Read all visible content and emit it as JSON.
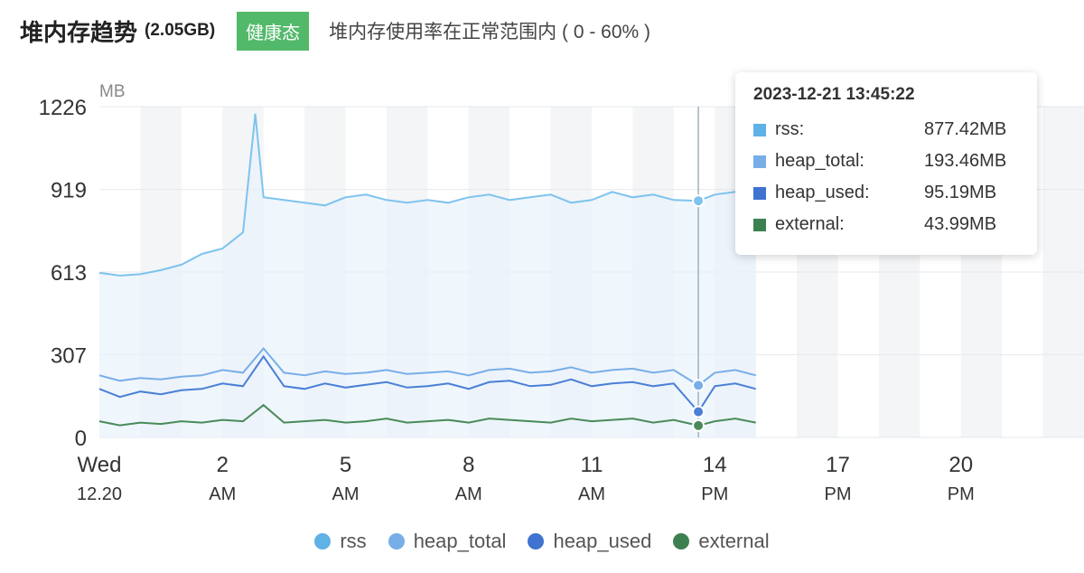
{
  "header": {
    "title": "堆内存趋势",
    "size": "(2.05GB)",
    "badge": "健康态",
    "description": "堆内存使用率在正常范围内 ( 0 - 60% )"
  },
  "colors": {
    "rss": "#7ec3ee",
    "heap_total": "#78aee8",
    "heap_used": "#4a7fd6",
    "external": "#4a8a5a",
    "badge": "#52b96a"
  },
  "tooltip": {
    "time": "2023-12-21 13:45:22",
    "rows": [
      {
        "name": "rss:",
        "value": "877.42MB",
        "color": "#5fb1e6"
      },
      {
        "name": "heap_total:",
        "value": "193.46MB",
        "color": "#78aee8"
      },
      {
        "name": "heap_used:",
        "value": "95.19MB",
        "color": "#3f73cf"
      },
      {
        "name": "external:",
        "value": "43.99MB",
        "color": "#3d8050"
      }
    ]
  },
  "legend": [
    {
      "name": "rss",
      "color": "#5fb1e6"
    },
    {
      "name": "heap_total",
      "color": "#78aee8"
    },
    {
      "name": "heap_used",
      "color": "#3f73cf"
    },
    {
      "name": "external",
      "color": "#3d8050"
    }
  ],
  "chart_data": {
    "type": "line",
    "ylabel": "MB",
    "ylim": [
      0,
      1226
    ],
    "yticks": [
      0,
      307,
      613,
      919,
      1226
    ],
    "xlim": [
      0,
      24
    ],
    "xticks": [
      {
        "hour": 0,
        "line1": "Wed",
        "line2": "12.20"
      },
      {
        "hour": 3,
        "line1": "2",
        "line2": "AM"
      },
      {
        "hour": 6,
        "line1": "5",
        "line2": "AM"
      },
      {
        "hour": 9,
        "line1": "8",
        "line2": "AM"
      },
      {
        "hour": 12,
        "line1": "11",
        "line2": "AM"
      },
      {
        "hour": 15,
        "line1": "14",
        "line2": "PM"
      },
      {
        "hour": 18,
        "line1": "17",
        "line2": "PM"
      },
      {
        "hour": 21,
        "line1": "20",
        "line2": "PM"
      }
    ],
    "hover_hour": 14.6,
    "series": [
      {
        "name": "rss",
        "x": [
          0,
          0.5,
          1,
          1.5,
          2,
          2.5,
          3,
          3.5,
          3.8,
          4,
          4.5,
          5,
          5.5,
          6,
          6.5,
          7,
          7.5,
          8,
          8.5,
          9,
          9.5,
          10,
          10.5,
          11,
          11.5,
          12,
          12.5,
          13,
          13.5,
          14,
          14.6,
          15,
          15.5,
          16
        ],
        "values": [
          610,
          600,
          605,
          620,
          640,
          680,
          700,
          760,
          1200,
          890,
          880,
          870,
          860,
          890,
          900,
          880,
          870,
          880,
          870,
          890,
          900,
          880,
          890,
          900,
          870,
          880,
          910,
          890,
          900,
          880,
          877,
          900,
          910,
          890
        ]
      },
      {
        "name": "heap_total",
        "x": [
          0,
          0.5,
          1,
          1.5,
          2,
          2.5,
          3,
          3.5,
          4,
          4.5,
          5,
          5.5,
          6,
          6.5,
          7,
          7.5,
          8,
          8.5,
          9,
          9.5,
          10,
          10.5,
          11,
          11.5,
          12,
          12.5,
          13,
          13.5,
          14,
          14.6,
          15,
          15.5,
          16
        ],
        "values": [
          230,
          210,
          220,
          215,
          225,
          230,
          250,
          240,
          330,
          240,
          230,
          245,
          235,
          240,
          250,
          235,
          240,
          245,
          230,
          250,
          255,
          240,
          245,
          260,
          240,
          250,
          255,
          240,
          250,
          193,
          240,
          250,
          230
        ]
      },
      {
        "name": "heap_used",
        "x": [
          0,
          0.5,
          1,
          1.5,
          2,
          2.5,
          3,
          3.5,
          4,
          4.5,
          5,
          5.5,
          6,
          6.5,
          7,
          7.5,
          8,
          8.5,
          9,
          9.5,
          10,
          10.5,
          11,
          11.5,
          12,
          12.5,
          13,
          13.5,
          14,
          14.6,
          15,
          15.5,
          16
        ],
        "values": [
          180,
          150,
          170,
          160,
          175,
          180,
          200,
          190,
          300,
          190,
          180,
          200,
          185,
          195,
          205,
          185,
          190,
          200,
          180,
          205,
          210,
          190,
          195,
          215,
          190,
          200,
          205,
          190,
          200,
          95,
          190,
          200,
          180
        ]
      },
      {
        "name": "external",
        "x": [
          0,
          0.5,
          1,
          1.5,
          2,
          2.5,
          3,
          3.5,
          4,
          4.5,
          5,
          5.5,
          6,
          6.5,
          7,
          7.5,
          8,
          8.5,
          9,
          9.5,
          10,
          10.5,
          11,
          11.5,
          12,
          12.5,
          13,
          13.5,
          14,
          14.6,
          15,
          15.5,
          16
        ],
        "values": [
          60,
          45,
          55,
          50,
          60,
          55,
          65,
          60,
          120,
          55,
          60,
          65,
          55,
          60,
          70,
          55,
          60,
          65,
          55,
          70,
          65,
          60,
          55,
          70,
          60,
          65,
          70,
          55,
          65,
          44,
          60,
          70,
          55
        ]
      }
    ]
  }
}
